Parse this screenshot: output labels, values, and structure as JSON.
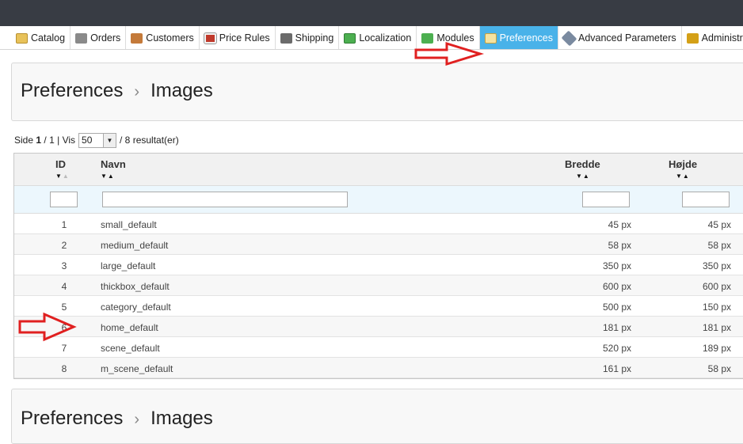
{
  "tabs": [
    {
      "label": "Catalog",
      "icon": "folder-icon",
      "icon_class": "ico-catalog"
    },
    {
      "label": "Orders",
      "icon": "cart-icon",
      "icon_class": "ico-orders"
    },
    {
      "label": "Customers",
      "icon": "user-icon",
      "icon_class": "ico-customers"
    },
    {
      "label": "Price Rules",
      "icon": "price-tag-icon",
      "icon_class": "ico-price"
    },
    {
      "label": "Shipping",
      "icon": "truck-icon",
      "icon_class": "ico-shipping"
    },
    {
      "label": "Localization",
      "icon": "globe-icon",
      "icon_class": "ico-local"
    },
    {
      "label": "Modules",
      "icon": "puzzle-icon",
      "icon_class": "ico-modules"
    },
    {
      "label": "Preferences",
      "icon": "preferences-icon",
      "icon_class": "ico-prefs",
      "active": true
    },
    {
      "label": "Advanced Parameters",
      "icon": "wrench-icon",
      "icon_class": "ico-adv"
    },
    {
      "label": "Administration",
      "icon": "key-icon",
      "icon_class": "ico-admin"
    }
  ],
  "breadcrumb": {
    "parent": "Preferences",
    "separator": "›",
    "current": "Images"
  },
  "pager": {
    "page_label": "Side",
    "page": "1",
    "pages": "1",
    "show_label": "Vis",
    "per_page": "50",
    "results": "/ 8 resultat(er)"
  },
  "table": {
    "headers": {
      "id": "ID",
      "name": "Navn",
      "width": "Bredde",
      "height": "Højde"
    },
    "rows": [
      {
        "id": "1",
        "name": "small_default",
        "width": "45 px",
        "height": "45 px"
      },
      {
        "id": "2",
        "name": "medium_default",
        "width": "58 px",
        "height": "58 px"
      },
      {
        "id": "3",
        "name": "large_default",
        "width": "350 px",
        "height": "350 px"
      },
      {
        "id": "4",
        "name": "thickbox_default",
        "width": "600 px",
        "height": "600 px"
      },
      {
        "id": "5",
        "name": "category_default",
        "width": "500 px",
        "height": "150 px"
      },
      {
        "id": "6",
        "name": "home_default",
        "width": "181 px",
        "height": "181 px"
      },
      {
        "id": "7",
        "name": "scene_default",
        "width": "520 px",
        "height": "189 px"
      },
      {
        "id": "8",
        "name": "m_scene_default",
        "width": "161 px",
        "height": "58 px"
      }
    ]
  },
  "colors": {
    "active_tab": "#49b2e9",
    "topbar": "#383c44",
    "annotation_arrow": "#e02020"
  }
}
